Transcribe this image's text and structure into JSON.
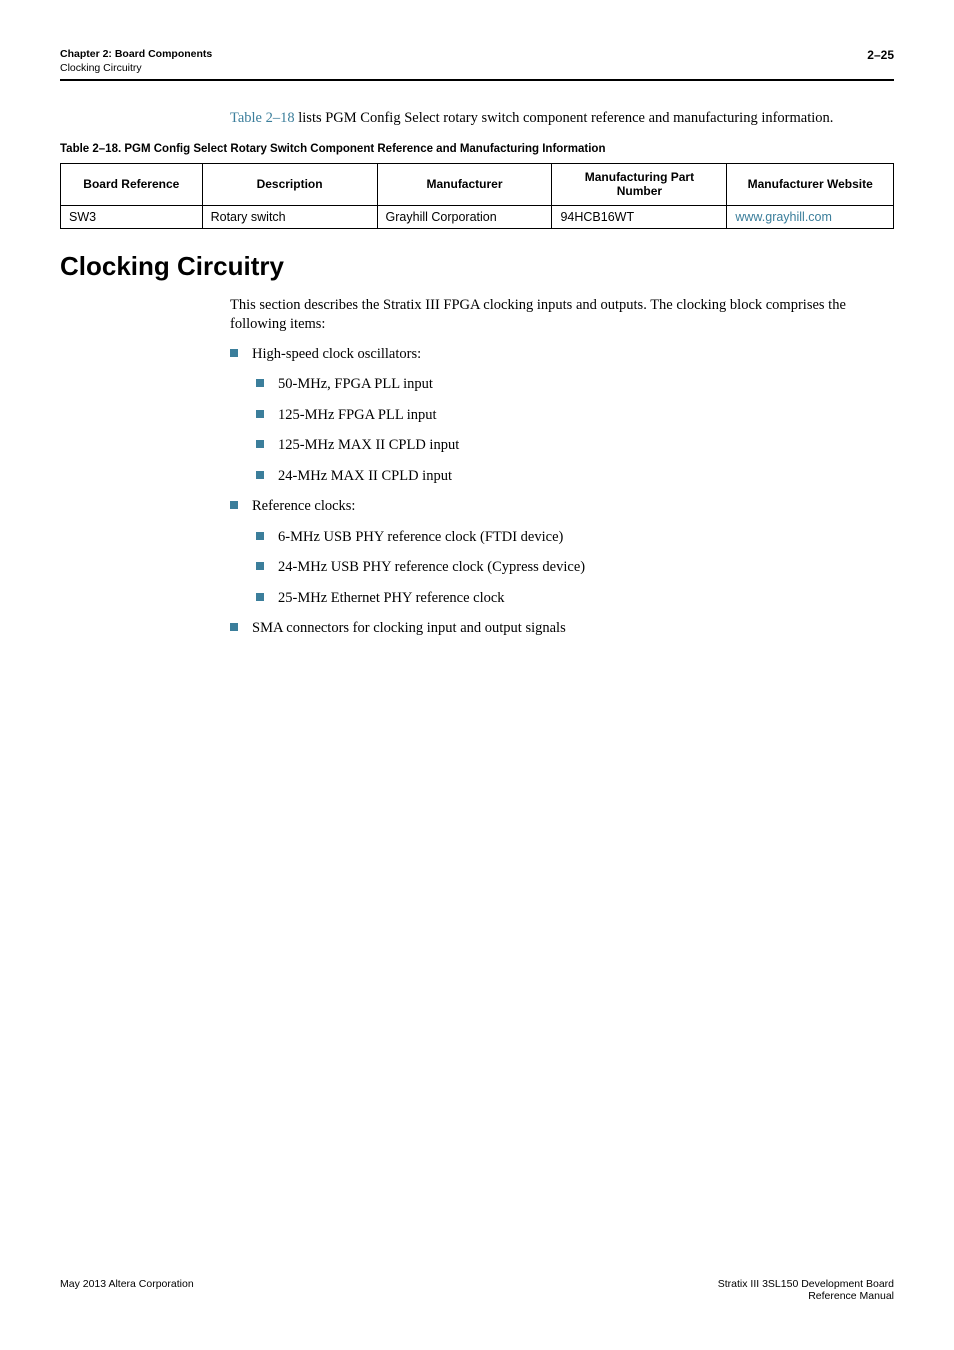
{
  "header": {
    "chapter": "Chapter 2:  Board Components",
    "subsection": "Clocking Circuitry",
    "page": "2–25"
  },
  "intro_para_prefix": "Table 2–18",
  "intro_para_rest": " lists PGM Config Select rotary switch component reference and manufacturing information.",
  "table_caption": "Table 2–18.  PGM Config Select Rotary Switch Component Reference and Manufacturing Information",
  "table": {
    "headers": [
      "Board Reference",
      "Description",
      "Manufacturer",
      "Manufacturing Part Number",
      "Manufacturer Website"
    ],
    "row": {
      "board_ref": "SW3",
      "description": "Rotary switch",
      "manufacturer": "Grayhill Corporation",
      "part_number": "94HCB16WT",
      "website": "www.grayhill.com"
    }
  },
  "section_heading": "Clocking Circuitry",
  "section_intro": "This section describes the Stratix III FPGA clocking inputs and outputs. The clocking block comprises the following items:",
  "bullets": {
    "b1": "High-speed clock oscillators:",
    "b1_sub": [
      "50-MHz, FPGA PLL input",
      "125-MHz FPGA PLL input",
      "125-MHz MAX II CPLD input",
      "24-MHz MAX II CPLD input"
    ],
    "b2": "Reference clocks:",
    "b2_sub": [
      "6-MHz USB PHY reference clock (FTDI device)",
      "24-MHz USB PHY reference clock (Cypress device)",
      "25-MHz Ethernet PHY reference clock"
    ],
    "b3": "SMA connectors for clocking input and output signals"
  },
  "footer": {
    "left": "May 2013    Altera Corporation",
    "right_line1": "Stratix III 3SL150 Development Board",
    "right_line2": "Reference Manual"
  }
}
